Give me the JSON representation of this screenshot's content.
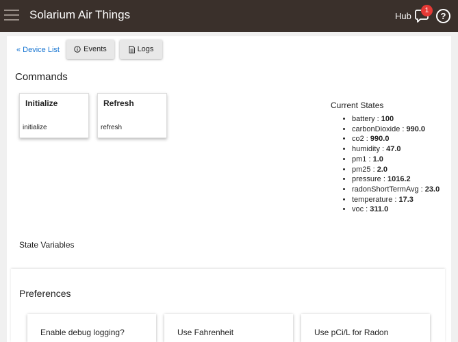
{
  "header": {
    "title": "Solarium Air Things",
    "hub_label": "Hub",
    "notification_count": "1",
    "help_symbol": "?",
    "menu_icon": "hamburger-menu-icon",
    "notification_icon": "chat-bell-icon",
    "help_icon": "question-circle-icon"
  },
  "nav": {
    "device_list": "« Device List",
    "events_label": "Events",
    "logs_label": "Logs"
  },
  "commands": {
    "title": "Commands",
    "items": [
      {
        "name": "Initialize",
        "param": "initialize"
      },
      {
        "name": "Refresh",
        "param": "refresh"
      }
    ]
  },
  "current_states": {
    "title": "Current States",
    "items": [
      {
        "key": "battery : ",
        "value": "100"
      },
      {
        "key": "carbonDioxide : ",
        "value": "990.0"
      },
      {
        "key": "co2 : ",
        "value": "990.0"
      },
      {
        "key": "humidity : ",
        "value": "47.0"
      },
      {
        "key": "pm1 : ",
        "value": "1.0"
      },
      {
        "key": "pm25 : ",
        "value": "2.0"
      },
      {
        "key": "pressure : ",
        "value": "1016.2"
      },
      {
        "key": "radonShortTermAvg : ",
        "value": "23.0"
      },
      {
        "key": "temperature : ",
        "value": "17.3"
      },
      {
        "key": "voc : ",
        "value": "311.0"
      }
    ]
  },
  "state_variables": {
    "title": "State Variables"
  },
  "preferences": {
    "title": "Preferences",
    "items": [
      "Enable debug logging?",
      "Use Fahrenheit",
      "Use pCi/L for Radon"
    ]
  },
  "colors": {
    "header_bg": "#3a302b",
    "link": "#1976d2",
    "badge": "#e53935"
  }
}
